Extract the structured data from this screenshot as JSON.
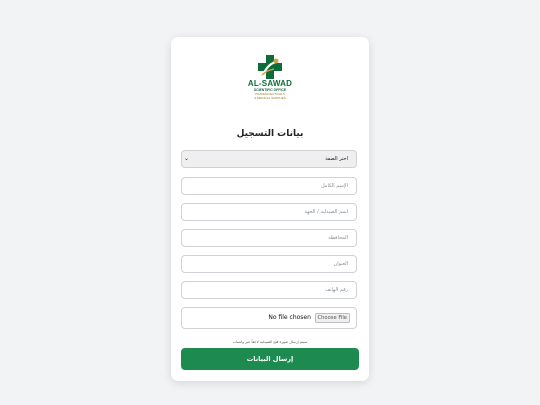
{
  "logo": {
    "name": "AL-SAWAD",
    "subtitle": "SCIENTIFIC OFFICE",
    "tagline_1": "PHARMACEUTICALS",
    "tagline_2": "& MEDICAL SUPPLIES"
  },
  "form": {
    "title": "بيانات التسجيل",
    "type_select": {
      "selected": "اختر الصفة"
    },
    "full_name": {
      "placeholder": "الإسم الكامل"
    },
    "pharmacy_name": {
      "placeholder": "اسم الصيدلية / الجهة"
    },
    "governorate": {
      "placeholder": "المحافظة"
    },
    "address": {
      "placeholder": "العنوان"
    },
    "phone": {
      "placeholder": "رقم الهاتف"
    },
    "file": {
      "status": "No file chosen",
      "button": "Choose File"
    },
    "note": "سيتم إرسال صورة فتح الصيدلية لاحقاً عبر واتساب",
    "submit_label": "إرسال البيانات"
  },
  "colors": {
    "brand_green": "#0f6b3a",
    "submit_green": "#1d8a4f",
    "gold": "#9b7a2f",
    "background": "#f2f3f5"
  }
}
